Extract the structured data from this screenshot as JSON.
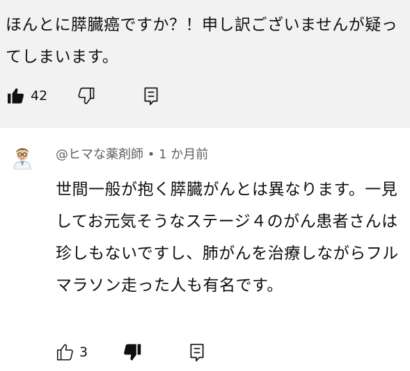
{
  "parent_comment": {
    "text": "ほんとに膵臓癌ですか？！申し訳ございませんが疑ってしまいます。",
    "like_count": "42",
    "liked": true,
    "disliked": false
  },
  "reply": {
    "author": "@ヒマな薬剤師",
    "separator": "•",
    "time": "1 か月前",
    "text": "世間一般が抱く膵臓がんとは異なります。一見してお元気そうなステージ４のがん患者さんは珍しもないですし、肺がんを治療しながらフルマラソン走った人も有名です。",
    "like_count": "3",
    "liked": false,
    "disliked": true
  },
  "icons": {
    "like_filled": "thumbs-up-filled-icon",
    "dislike_outline": "thumbs-down-outline-icon",
    "like_outline": "thumbs-up-outline-icon",
    "dislike_filled": "thumbs-down-filled-icon",
    "reply": "reply-comment-icon",
    "avatar": "pharmacist-avatar-icon"
  },
  "colors": {
    "parent_background": "#f2f2f2",
    "meta_text": "#606060",
    "text": "#0f0f0f"
  }
}
